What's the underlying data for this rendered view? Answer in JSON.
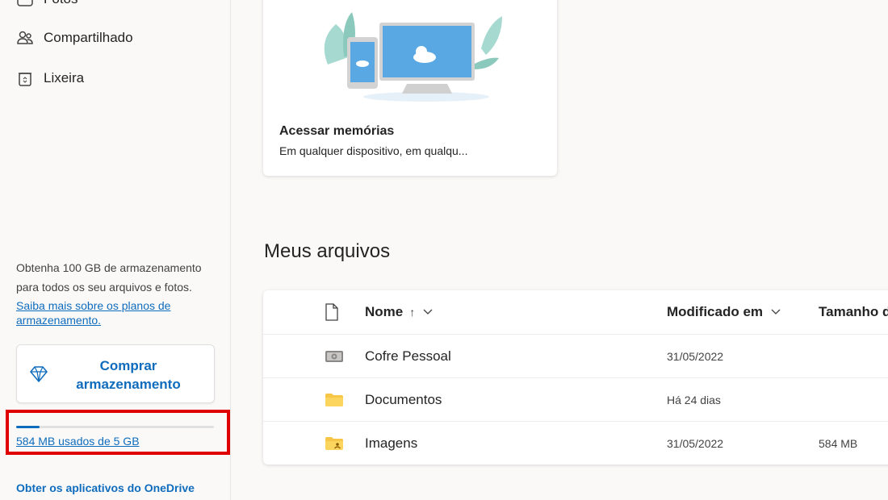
{
  "sidebar": {
    "partial_top_label": "Fotos",
    "items": [
      {
        "label": "Compartilhado",
        "icon": "people-icon"
      },
      {
        "label": "Lixeira",
        "icon": "recycle-bin-icon"
      }
    ],
    "promo_text": "Obtenha 100 GB de armazenamento para todos os seu arquivos e fotos.",
    "promo_link": "Saiba mais sobre os planos de armazenamento.",
    "buy_button": "Comprar armazenamento",
    "storage_text": "584 MB usados de 5 GB",
    "storage_used_fraction": 0.117,
    "apps_link": "Obter os aplicativos do OneDrive"
  },
  "card": {
    "title": "Acessar memórias",
    "subtitle": "Em qualquer dispositivo, em qualqu..."
  },
  "files_section": {
    "title": "Meus arquivos",
    "columns": {
      "name": "Nome",
      "name_sort": "↑",
      "modified": "Modificado em",
      "size": "Tamanho d"
    },
    "rows": [
      {
        "name": "Cofre Pessoal",
        "modified": "31/05/2022",
        "size": "",
        "icon": "vault-icon"
      },
      {
        "name": "Documentos",
        "modified": "Há 24 dias",
        "size": "",
        "icon": "folder-icon"
      },
      {
        "name": "Imagens",
        "modified": "31/05/2022",
        "size": "584 MB",
        "icon": "pictures-folder-icon"
      }
    ]
  },
  "colors": {
    "accent": "#0f6cbd",
    "highlight": "#e00000",
    "folder": "#f8c647"
  }
}
